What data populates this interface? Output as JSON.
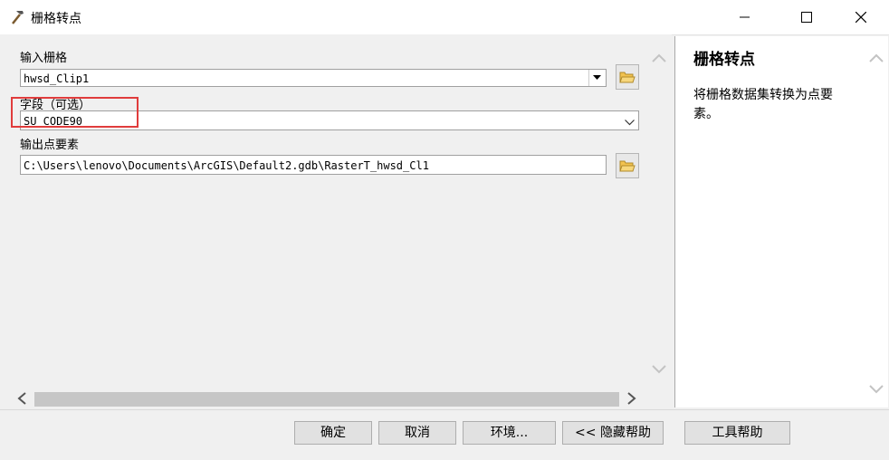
{
  "window": {
    "title": "栅格转点"
  },
  "form": {
    "input_raster": {
      "label": "输入栅格",
      "value": "hwsd_Clip1"
    },
    "field": {
      "label": "字段（可选）",
      "value": "SU_CODE90"
    },
    "output_points": {
      "label": "输出点要素",
      "value": "C:\\Users\\lenovo\\Documents\\ArcGIS\\Default2.gdb\\RasterT_hwsd_Cl1"
    }
  },
  "help": {
    "title": "栅格转点",
    "description": "将栅格数据集转换为点要素。"
  },
  "buttons": {
    "ok": "确定",
    "cancel": "取消",
    "environments": "环境...",
    "hide_help": "<< 隐藏帮助",
    "tool_help": "工具帮助"
  },
  "colors": {
    "highlight_box": "#e03c3c",
    "background": "#f0f0f0"
  }
}
